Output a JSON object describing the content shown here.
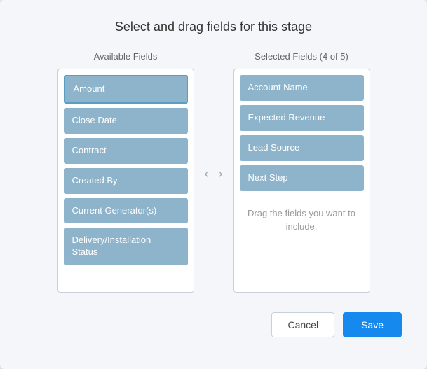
{
  "dialog": {
    "title": "Select and drag fields for this stage",
    "available_column_header": "Available Fields",
    "selected_column_header": "Selected Fields (4 of 5)",
    "drop_hint": "Drag the fields you want to include.",
    "available_fields": [
      {
        "label": "Amount"
      },
      {
        "label": "Close Date"
      },
      {
        "label": "Contract"
      },
      {
        "label": "Created By"
      },
      {
        "label": "Current Generator(s)"
      },
      {
        "label": "Delivery/Installation Status"
      }
    ],
    "selected_fields": [
      {
        "label": "Account Name"
      },
      {
        "label": "Expected Revenue"
      },
      {
        "label": "Lead Source"
      },
      {
        "label": "Next Step"
      }
    ],
    "buttons": {
      "cancel": "Cancel",
      "save": "Save"
    },
    "arrows": {
      "left": "‹",
      "right": "›"
    }
  }
}
